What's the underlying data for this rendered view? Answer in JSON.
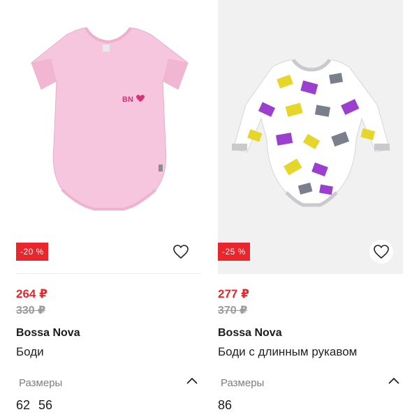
{
  "products": [
    {
      "discount": "-20 %",
      "price_new": "264 ₽",
      "price_old": "330 ₽",
      "brand": "Bossa Nova",
      "name": "Боди",
      "sizes_label": "Размеры",
      "sizes": [
        "62",
        "56"
      ],
      "image_logo": "BN",
      "colors": {
        "garment": "#f5c6dd",
        "trim": "#f0b6d2",
        "logo": "#d9307a"
      }
    },
    {
      "discount": "-25 %",
      "price_new": "277 ₽",
      "price_old": "370 ₽",
      "brand": "Bossa Nova",
      "name": "Боди с длинным рукавом",
      "sizes_label": "Размеры",
      "sizes": [
        "86"
      ],
      "colors": {
        "garment": "#ffffff",
        "trim": "#cfcfd4",
        "print_purple": "#9b3fcf",
        "print_yellow": "#e6d62a",
        "print_gray": "#7b7f8c"
      }
    }
  ],
  "icons": {
    "favorite": "heart-outline-icon",
    "collapse": "chevron-up-icon"
  },
  "accent_color": "#e8262b"
}
